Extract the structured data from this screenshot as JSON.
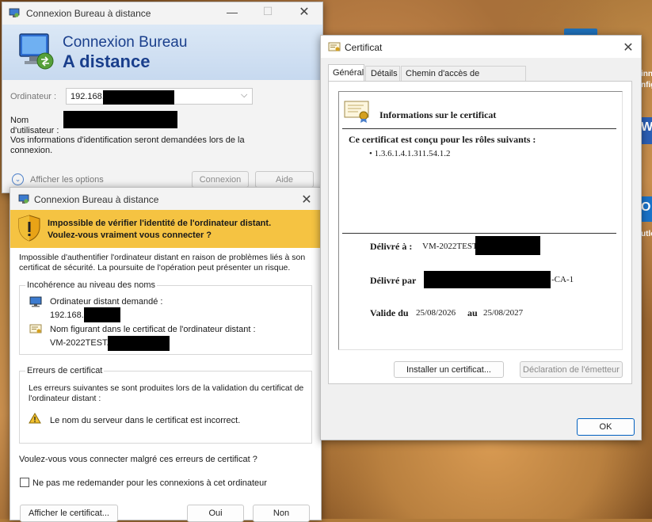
{
  "rdc": {
    "title": "Connexion Bureau à distance",
    "header_line1": "Connexion Bureau",
    "header_line2": "A distance",
    "computer_label": "Ordinateur :",
    "computer_value": "192.168.",
    "username_label": "Nom d'utilisateur :",
    "info_text": "Vos informations d'identification seront demandées lors de la connexion.",
    "show_options": "Afficher les options",
    "connect": "Connexion",
    "help": "Aide"
  },
  "warning": {
    "title": "Connexion Bureau à distance",
    "banner_line1": "Impossible de vérifier l'identité de l'ordinateur distant.",
    "banner_line2": "Voulez-vous vraiment vous connecter ?",
    "intro": "Impossible d'authentifier l'ordinateur distant en raison de problèmes liés à son certificat de sécurité. La poursuite de l'opération peut présenter un risque.",
    "name_group_label": "Incohérence au niveau des noms",
    "requested_label": "Ordinateur distant demandé :",
    "requested_value": "192.168.",
    "cert_name_label": "Nom figurant dans le certificat de l'ordinateur distant :",
    "cert_name_value": "VM-2022TEST.",
    "errors_group_label": "Erreurs de certificat",
    "errors_intro": "Les erreurs suivantes se sont produites lors de la validation du certificat de l'ordinateur distant :",
    "error_item": "Le nom du serveur dans le certificat est incorrect.",
    "question": "Voulez-vous vous connecter malgré ces erreurs de certificat ?",
    "dont_ask": "Ne pas me redemander pour les connexions à cet ordinateur",
    "view_cert": "Afficher le certificat...",
    "yes": "Oui",
    "no": "Non"
  },
  "cert": {
    "title": "Certificat",
    "tabs": [
      "Général",
      "Détails",
      "Chemin d'accès de certification"
    ],
    "info_title": "Informations sur le certificat",
    "purpose_heading": "Ce certificat est conçu pour les rôles suivants :",
    "purpose_item": "• 1.3.6.1.4.1.311.54.1.2",
    "issued_to_label": "Délivré à :",
    "issued_to_value": "VM-2022TEST",
    "issued_by_label": "Délivré par",
    "issued_by_suffix": "-CA-1",
    "valid_label": "Valide du",
    "valid_from": "25/08/2026",
    "valid_to_label": "au",
    "valid_to": "25/08/2027",
    "install_btn": "Installer un certificat...",
    "issuer_stmt_btn": "Déclaration de l'émetteur",
    "ok": "OK"
  },
  "desktop": {
    "label_fragments": [
      "inn",
      "nfig",
      "W",
      "O",
      "utlo"
    ]
  }
}
